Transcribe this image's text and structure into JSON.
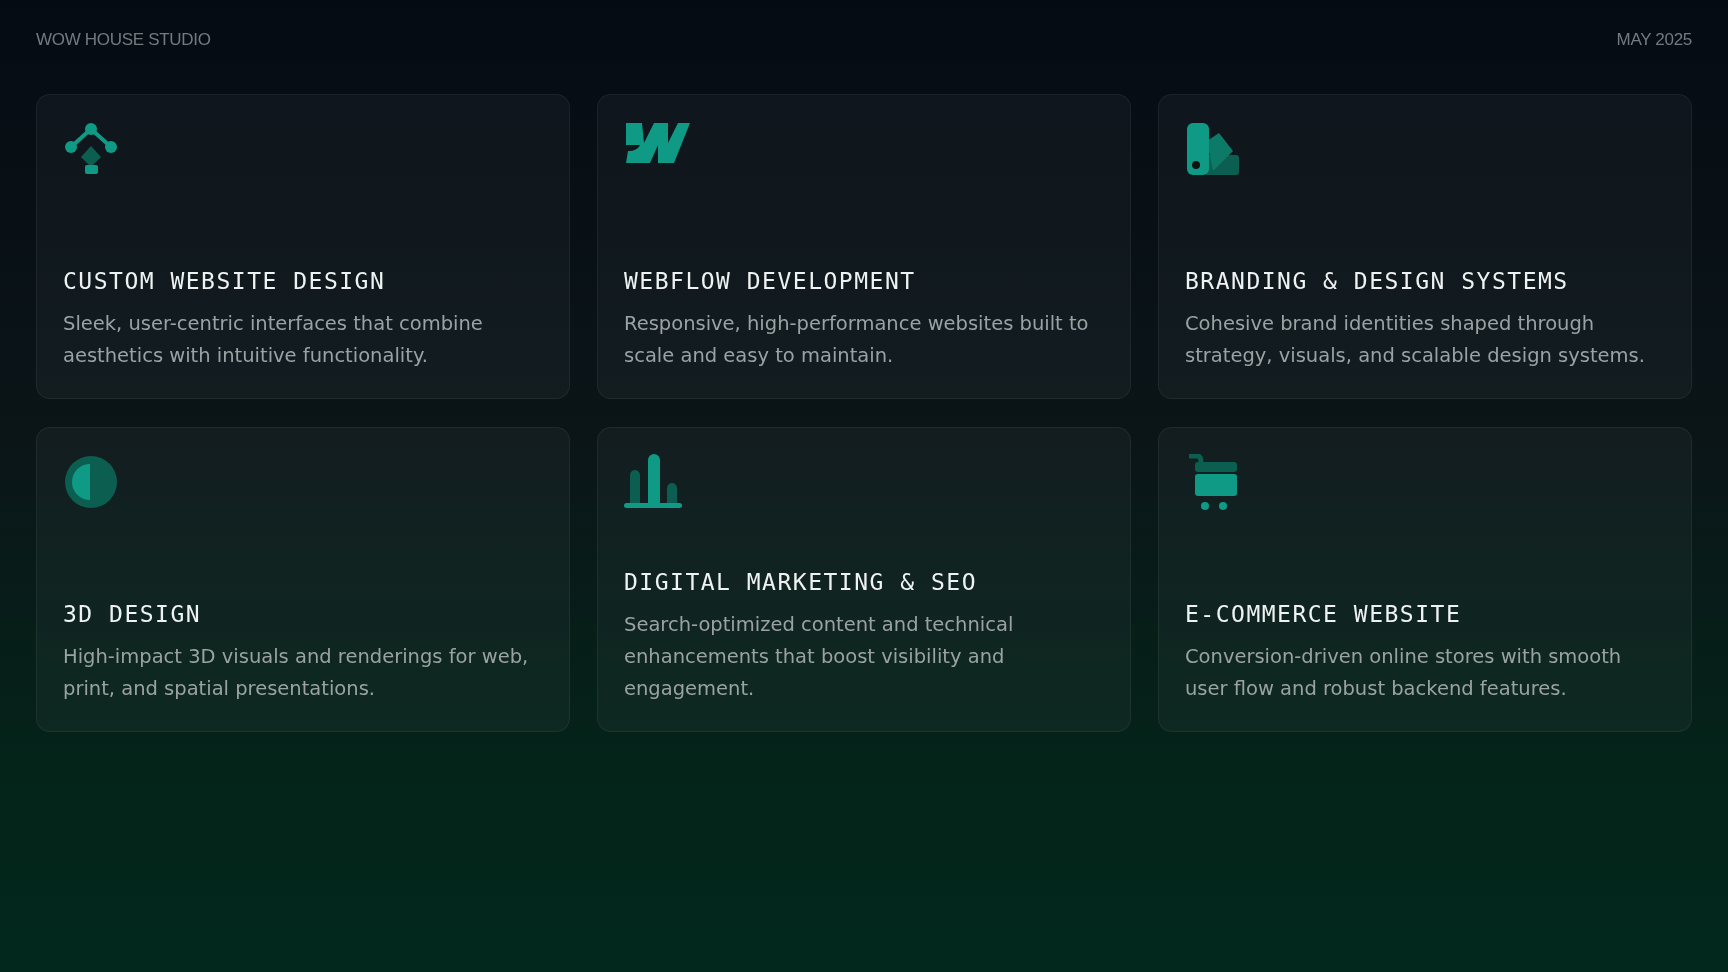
{
  "header": {
    "studio": "WOW HOUSE STUDIO",
    "date": "MAY 2025"
  },
  "services": [
    {
      "title": "CUSTOM WEBSITE DESIGN",
      "description": "Sleek, user-centric interfaces that combine aesthetics with intuitive functionality."
    },
    {
      "title": "WEBFLOW DEVELOPMENT",
      "description": "Responsive, high-performance websites built to scale and easy to maintain."
    },
    {
      "title": "BRANDING & DESIGN SYSTEMS",
      "description": "Cohesive brand identities shaped through strategy, visuals, and scalable design systems."
    },
    {
      "title": "3D DESIGN",
      "description": "High-impact 3D visuals and renderings for web, print, and spatial presentations."
    },
    {
      "title": "DIGITAL MARKETING & SEO",
      "description": "Search-optimized content and technical enhancements that boost visibility and engagement."
    },
    {
      "title": "E-COMMERCE WEBSITE",
      "description": "Conversion-driven online stores with smooth user flow and robust backend features."
    }
  ]
}
